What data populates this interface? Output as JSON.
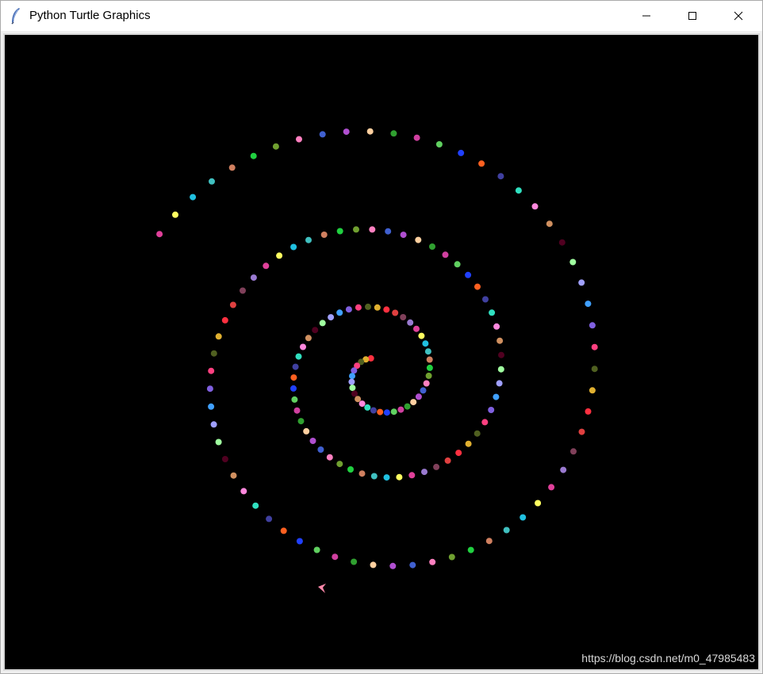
{
  "window": {
    "title": "Python Turtle Graphics",
    "icon": "feather-icon",
    "controls": [
      "minimize-icon",
      "maximize-icon",
      "close-icon"
    ]
  },
  "canvas": {
    "background": "#000000",
    "turtle_color": "#ff88aa",
    "dot_palette": [
      "#e0409a",
      "#b04fd0",
      "#ff88dd",
      "#e0b030",
      "#d08060",
      "#60d060",
      "#a0a0ff",
      "#9a7ad0",
      "#4060d0",
      "#30e0c0",
      "#506020",
      "#40c0c0",
      "#d040a0",
      "#a0ffa0",
      "#80405a",
      "#ff80c0",
      "#4040a0",
      "#ff4080",
      "#20c0e0",
      "#30a030",
      "#500020",
      "#e04040",
      "#70a030",
      "#ff6020",
      "#8060e0",
      "#ffff60",
      "#ffd0a0",
      "#d09060",
      "#ff3040",
      "#20d040",
      "#2040ff",
      "#40a0ff"
    ]
  },
  "watermark": "https://blog.csdn.net/m0_47985483"
}
